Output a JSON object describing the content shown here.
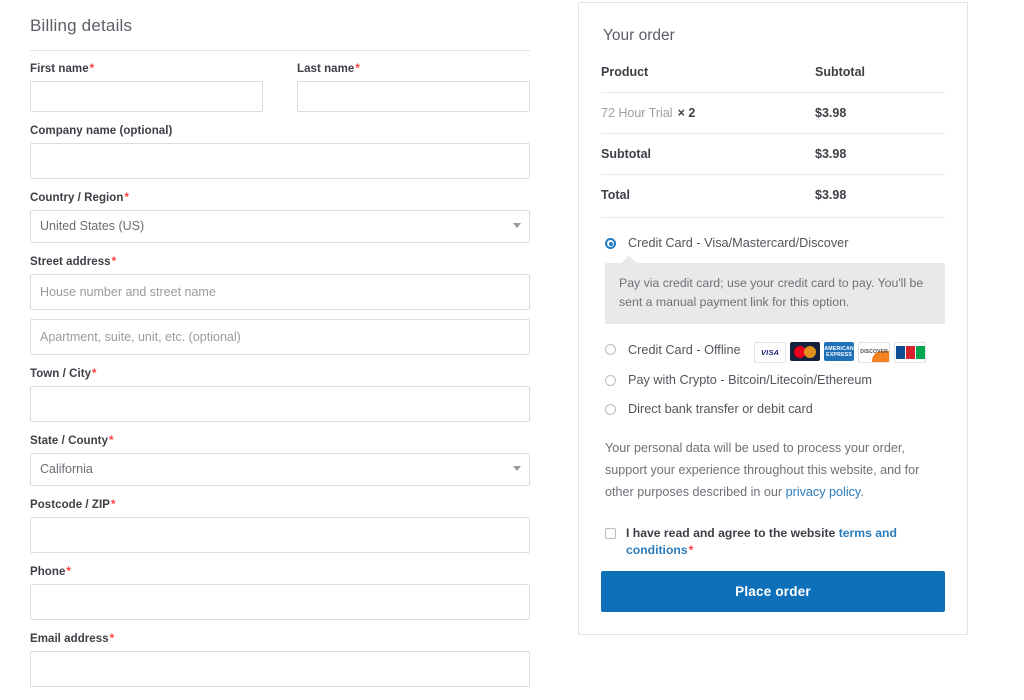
{
  "billing": {
    "title": "Billing details",
    "required_mark": "*",
    "fields": [
      {
        "label": "First name",
        "required": true,
        "value": "",
        "placeholder": ""
      },
      {
        "label": "Last name",
        "required": true,
        "value": "",
        "placeholder": ""
      },
      {
        "label": "Company name (optional)",
        "required": false,
        "value": "",
        "placeholder": ""
      },
      {
        "label": "Country / Region",
        "required": true,
        "value": "United States (US)",
        "placeholder": ""
      },
      {
        "label": "Street address",
        "required": true,
        "value": "",
        "placeholder": "House number and street name"
      },
      {
        "label": "",
        "required": false,
        "value": "",
        "placeholder": "Apartment, suite, unit, etc. (optional)"
      },
      {
        "label": "Town / City",
        "required": true,
        "value": "",
        "placeholder": ""
      },
      {
        "label": "State / County",
        "required": true,
        "value": "California",
        "placeholder": ""
      },
      {
        "label": "Postcode / ZIP",
        "required": true,
        "value": "",
        "placeholder": ""
      },
      {
        "label": "Phone",
        "required": true,
        "value": "",
        "placeholder": ""
      },
      {
        "label": "Email address",
        "required": true,
        "value": "",
        "placeholder": ""
      }
    ]
  },
  "order": {
    "title": "Your order",
    "columns": {
      "product": "Product",
      "subtotal": "Subtotal"
    },
    "line_items": [
      {
        "name": "72 Hour Trial",
        "qty": "× 2",
        "amount": "$3.98"
      }
    ],
    "totals": [
      {
        "label": "Subtotal",
        "amount": "$3.98"
      },
      {
        "label": "Total",
        "amount": "$3.98"
      }
    ]
  },
  "payment": {
    "methods": [
      {
        "label": "Credit Card - Visa/Mastercard/Discover",
        "selected": true
      },
      {
        "label": "Credit Card - Offline",
        "selected": false
      },
      {
        "label": "Pay with Crypto - Bitcoin/Litecoin/Ethereum",
        "selected": false
      },
      {
        "label": "Direct bank transfer or debit card",
        "selected": false
      }
    ],
    "selected_description": "Pay via credit card; use your credit card to pay. You'll be sent a manual payment link for this option.",
    "card_brands": [
      "visa",
      "mastercard",
      "american-express",
      "discover",
      "jcb"
    ],
    "card_labels": {
      "visa": "VISA",
      "amex": "AMERICAN EXPRESS",
      "discover": "DISCOVER"
    }
  },
  "legal": {
    "privacy_text_before": "Your personal data will be used to process your order, support your experience throughout this website, and for other purposes described in our ",
    "privacy_link": "privacy policy",
    "privacy_text_after": ".",
    "terms_before": "I have read and agree to the website ",
    "terms_link": "terms and conditions",
    "terms_required": "*"
  },
  "actions": {
    "place_order": "Place order"
  },
  "colors": {
    "accent": "#0f70ba",
    "link": "#2c7cbb",
    "required": "#ff3c3c",
    "panel_border": "#e2e2e2",
    "description_bg": "#e9e9e9"
  }
}
